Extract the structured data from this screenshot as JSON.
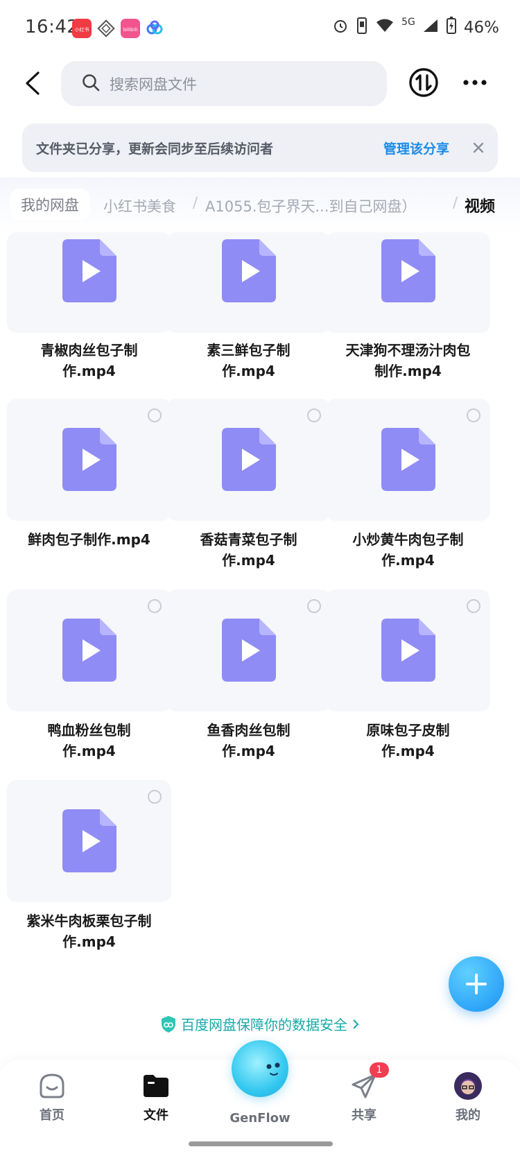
{
  "status_bar": {
    "time": "16:42",
    "network": "5G",
    "battery": "46%",
    "app_icons": [
      "xiaohongshu-icon",
      "grid-app-icon",
      "bilibili-icon",
      "baidu-netdisk-icon"
    ],
    "app_icon_labels": {
      "xiaohongshu": "小红书",
      "bilibili": "bilibili"
    }
  },
  "header": {
    "search_placeholder": "搜索网盘文件"
  },
  "share_banner": {
    "notice": "文件夹已分享，更新会同步至后续访问者",
    "manage_label": "管理该分享"
  },
  "breadcrumb": {
    "items": [
      "我的网盘",
      "小红书美食",
      "A1055.包子界天...到自己网盘）",
      "视频"
    ],
    "separator": "/"
  },
  "files": [
    {
      "name_line1": "青椒肉丝包子制",
      "name_line2": "作.mp4"
    },
    {
      "name_line1": "素三鲜包子制",
      "name_line2": "作.mp4"
    },
    {
      "name_line1": "天津狗不理汤汁肉包",
      "name_line2": "制作.mp4"
    },
    {
      "name_line1": "鲜肉包子制作.mp4",
      "name_line2": ""
    },
    {
      "name_line1": "香菇青菜包子制",
      "name_line2": "作.mp4"
    },
    {
      "name_line1": "小炒黄牛肉包子制",
      "name_line2": "作.mp4"
    },
    {
      "name_line1": "鸭血粉丝包制",
      "name_line2": "作.mp4"
    },
    {
      "name_line1": "鱼香肉丝包制",
      "name_line2": "作.mp4"
    },
    {
      "name_line1": "原味包子皮制",
      "name_line2": "作.mp4"
    },
    {
      "name_line1": "紫米牛肉板栗包子制",
      "name_line2": "作.mp4"
    }
  ],
  "security_notice": "百度网盘保障你的数据安全",
  "bottom_nav": {
    "home": "首页",
    "files": "文件",
    "genflow": "GenFlow",
    "share": "共享",
    "share_badge": "1",
    "mine": "我的"
  },
  "colors": {
    "accent": "#1c8be8",
    "file_icon": "#8f8cf5",
    "badge": "#f23d52"
  }
}
